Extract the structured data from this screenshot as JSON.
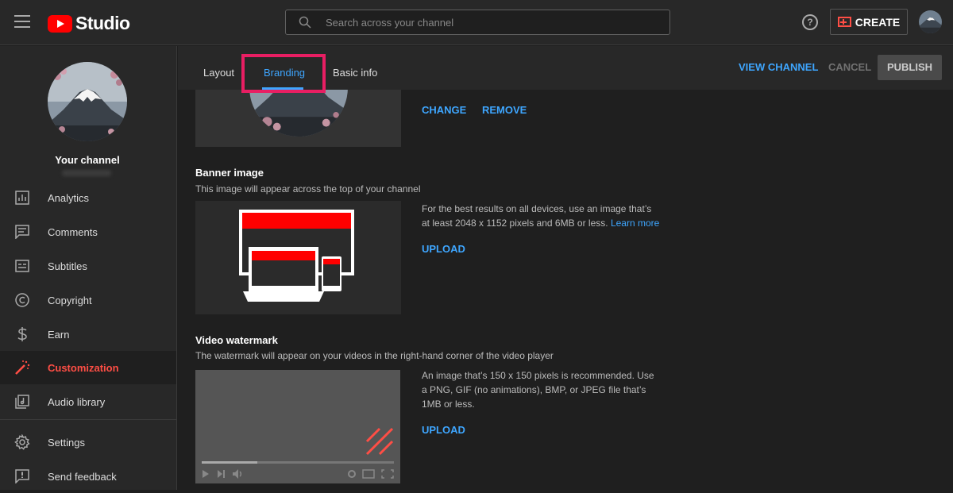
{
  "app": {
    "logo_text": "Studio"
  },
  "search": {
    "placeholder": "Search across your channel"
  },
  "header": {
    "create_label": "CREATE"
  },
  "sidebar": {
    "title": "Your channel",
    "items": [
      {
        "label": "Analytics",
        "icon": "analytics-icon"
      },
      {
        "label": "Comments",
        "icon": "comments-icon"
      },
      {
        "label": "Subtitles",
        "icon": "subtitles-icon"
      },
      {
        "label": "Copyright",
        "icon": "copyright-icon"
      },
      {
        "label": "Earn",
        "icon": "dollar-icon"
      },
      {
        "label": "Customization",
        "icon": "magic-wand-icon",
        "active": true
      },
      {
        "label": "Audio library",
        "icon": "audio-library-icon"
      },
      {
        "label": "Settings",
        "icon": "gear-icon"
      },
      {
        "label": "Send feedback",
        "icon": "feedback-icon"
      }
    ]
  },
  "tabs": [
    {
      "label": "Layout"
    },
    {
      "label": "Branding",
      "active": true
    },
    {
      "label": "Basic info"
    }
  ],
  "actions": {
    "view_channel": "VIEW CHANNEL",
    "cancel": "CANCEL",
    "publish": "PUBLISH"
  },
  "picture": {
    "change": "CHANGE",
    "remove": "REMOVE"
  },
  "banner": {
    "title": "Banner image",
    "description": "This image will appear across the top of your channel",
    "help": "For the best results on all devices, use an image that’s at least 2048 x 1152 pixels and 6MB or less.",
    "learn_more": "Learn more",
    "upload": "UPLOAD"
  },
  "watermark": {
    "title": "Video watermark",
    "description": "The watermark will appear on your videos in the right-hand corner of the video player",
    "help": "An image that’s 150 x 150 pixels is recommended. Use a PNG, GIF (no animations), BMP, or JPEG file that’s 1MB or less.",
    "upload": "UPLOAD",
    "progress": 0.29
  },
  "colors": {
    "accent": "#3ea6ff",
    "brand_red": "#ff0000",
    "active_red": "#ff4e45",
    "highlight": "#e91e63"
  }
}
